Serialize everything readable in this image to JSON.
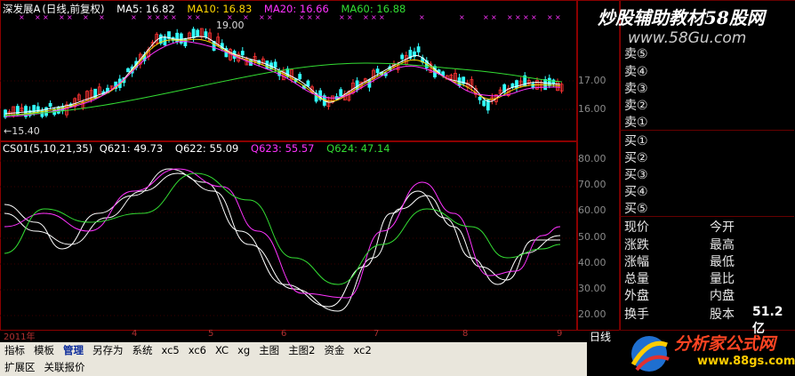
{
  "main_legend": {
    "stock": "深发展A",
    "period": "(日线,前复权)",
    "ma5": "MA5: 16.82",
    "ma10": "MA10: 16.83",
    "ma20": "MA20: 16.66",
    "ma60": "MA60: 16.88"
  },
  "annotations": {
    "high": "19.00",
    "low": "←15.40"
  },
  "main_yticks": [
    "17.00",
    "16.00"
  ],
  "indicator_legend": {
    "name": "CS01(5,10,21,35)",
    "q621": "Q621: 49.73",
    "q622": "Q622: 55.09",
    "q623": "Q623: 55.57",
    "q624": "Q624: 47.14"
  },
  "indicator_yticks": [
    "80.00",
    "70.00",
    "60.00",
    "50.00",
    "40.00",
    "30.00",
    "20.00"
  ],
  "x_labels": [
    "2011年",
    "4",
    "5",
    "6",
    "7",
    "8",
    "9"
  ],
  "order_book": {
    "sell": [
      "卖⑤",
      "卖④",
      "卖③",
      "卖②",
      "卖①"
    ],
    "buy": [
      "买①",
      "买②",
      "买③",
      "买④",
      "买⑤"
    ]
  },
  "quote": {
    "left": [
      "现价",
      "涨跌",
      "涨幅",
      "总量",
      "外盘",
      "换手"
    ],
    "right": [
      "今开",
      "最高",
      "最低",
      "量比",
      "内盘",
      "股本"
    ],
    "capital_value": "51.2亿"
  },
  "toolbar": {
    "items": [
      "指标",
      "模板",
      "管理",
      "另存为",
      "系统",
      "xc5",
      "xc6",
      "XC",
      "xg",
      "主图",
      "主图2",
      "资金",
      "xc2"
    ],
    "active_index": 2
  },
  "bottom_tabs": [
    "扩展区",
    "关联报价"
  ],
  "period_label": "日线",
  "watermark": {
    "top": "炒股辅助教材58股网",
    "url": "www.58Gu.com",
    "bottom": "分析家公式网",
    "bottom_url": "www.88gs.com"
  },
  "colors": {
    "ma5": "#ffffff",
    "ma10": "#ffd700",
    "ma20": "#ff33ff",
    "ma60": "#33dd33",
    "up": "#ff3333",
    "down": "#33ffff",
    "border": "#8b0000"
  }
}
